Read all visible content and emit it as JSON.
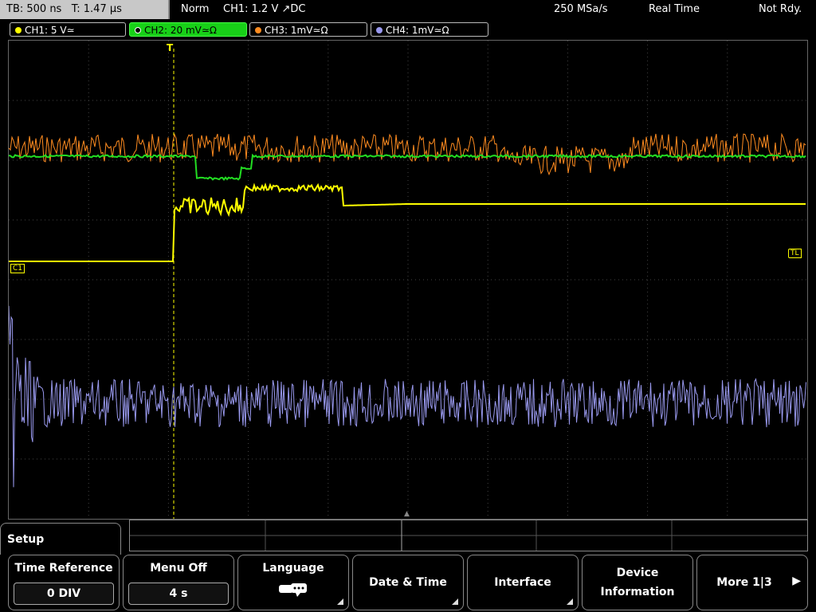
{
  "status": {
    "timebase": "TB: 500 ns",
    "trigger_time": "T: 1.47 µs",
    "mode": "Norm",
    "trigger_channel": "CH1: 1.2 V ↗DC",
    "sample_rate": "250 MSa/s",
    "acquisition": "Real Time",
    "state": "Not Rdy."
  },
  "channels": [
    {
      "label": "CH1: 5 V≃",
      "color": "#ffff00",
      "active": false
    },
    {
      "label": "CH2: 20 mV≃Ω",
      "color": "#22dd22",
      "active": true
    },
    {
      "label": "CH3: 1mV≃Ω",
      "color": "#ff8c20",
      "active": false
    },
    {
      "label": "CH4: 1mV≃Ω",
      "color": "#9999ee",
      "active": false
    }
  ],
  "markers": {
    "trigger_level": "TL",
    "ch1_ground": "C1"
  },
  "menu": {
    "title": "Setup",
    "softkeys": [
      {
        "label": "Time Reference",
        "value": "0 DIV"
      },
      {
        "label": "Menu Off",
        "value": "4 s"
      },
      {
        "label": "Language",
        "icon": "speech-bubbles-icon"
      },
      {
        "label": "Date & Time"
      },
      {
        "label": "Interface"
      },
      {
        "label": "Device Information",
        "line1": "Device",
        "line2": "Information"
      },
      {
        "label": "More 1|3"
      }
    ]
  }
}
